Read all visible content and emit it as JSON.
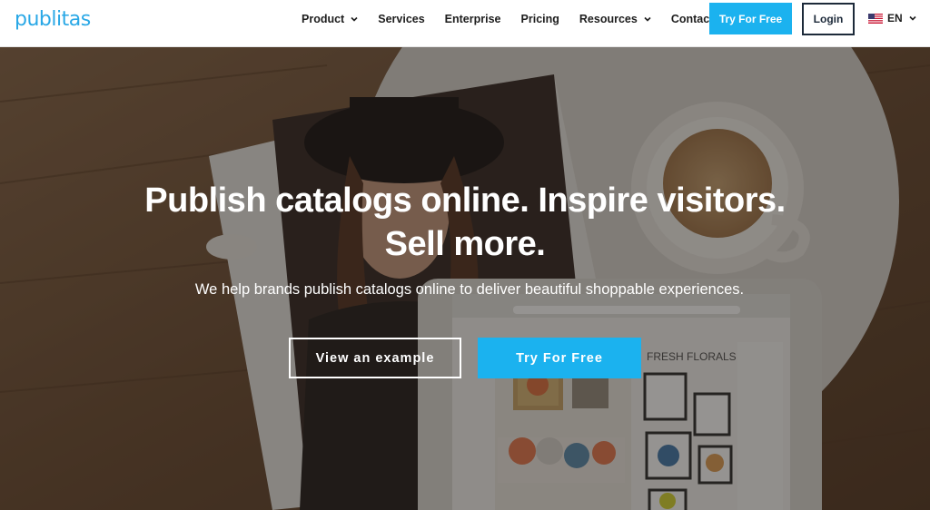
{
  "header": {
    "logo": "publitas",
    "nav": [
      {
        "label": "Product",
        "has_dropdown": true
      },
      {
        "label": "Services",
        "has_dropdown": false
      },
      {
        "label": "Enterprise",
        "has_dropdown": false
      },
      {
        "label": "Pricing",
        "has_dropdown": false
      },
      {
        "label": "Resources",
        "has_dropdown": true
      },
      {
        "label": "Contact",
        "has_dropdown": false
      }
    ],
    "try_button": "Try For Free",
    "login_button": "Login",
    "language": "EN",
    "language_icon": "us-flag-icon"
  },
  "hero": {
    "headline_line1": "Publish catalogs online. Inspire visitors.",
    "headline_line2": "Sell more.",
    "subline": "We help brands publish catalogs online to deliver beautiful shoppable experiences.",
    "example_button": "View an example",
    "try_button": "Try For Free",
    "tablet_heading": "FRESH FLORALS"
  },
  "colors": {
    "brand": "#2aa8e6",
    "accent": "#1bb2ef",
    "dark": "#1d2a3a"
  }
}
